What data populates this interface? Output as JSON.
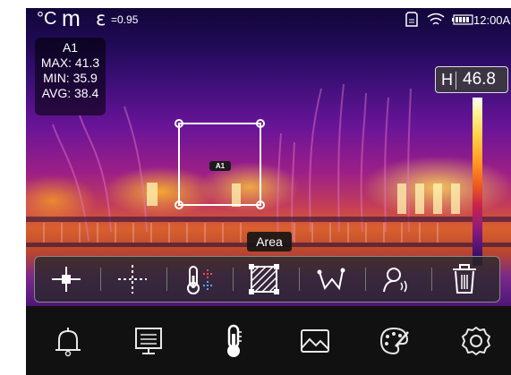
{
  "status": {
    "unit": "°C",
    "mode": "m",
    "emissivity_symbol": "ε",
    "emissivity_value": "=0.95",
    "time": "12:00AM"
  },
  "measurement": {
    "name": "A1",
    "max": "MAX: 41.3",
    "min": "MIN: 35.9",
    "avg": "AVG: 38.4"
  },
  "scale": {
    "label": "H",
    "value": "46.8"
  },
  "area_tag": "A1",
  "tooltip": "Area",
  "tools": [
    {
      "name": "center-point-icon",
      "selected": false
    },
    {
      "name": "cross-cursor-icon",
      "selected": false
    },
    {
      "name": "thermometer-probe-icon",
      "selected": false
    },
    {
      "name": "area-box-icon",
      "selected": true
    },
    {
      "name": "line-measure-icon",
      "selected": false
    },
    {
      "name": "user-alert-icon",
      "selected": false
    },
    {
      "name": "trash-icon",
      "selected": false
    }
  ],
  "nav": [
    {
      "name": "bell-icon",
      "selected": false
    },
    {
      "name": "monitor-icon",
      "selected": false
    },
    {
      "name": "thermometer-icon",
      "selected": true
    },
    {
      "name": "image-icon",
      "selected": false
    },
    {
      "name": "palette-icon",
      "selected": false
    },
    {
      "name": "settings-gear-icon",
      "selected": false
    }
  ],
  "colors": {
    "accent": "#ffffff",
    "nav_background": "#111111",
    "tool_strip": "#282828"
  }
}
